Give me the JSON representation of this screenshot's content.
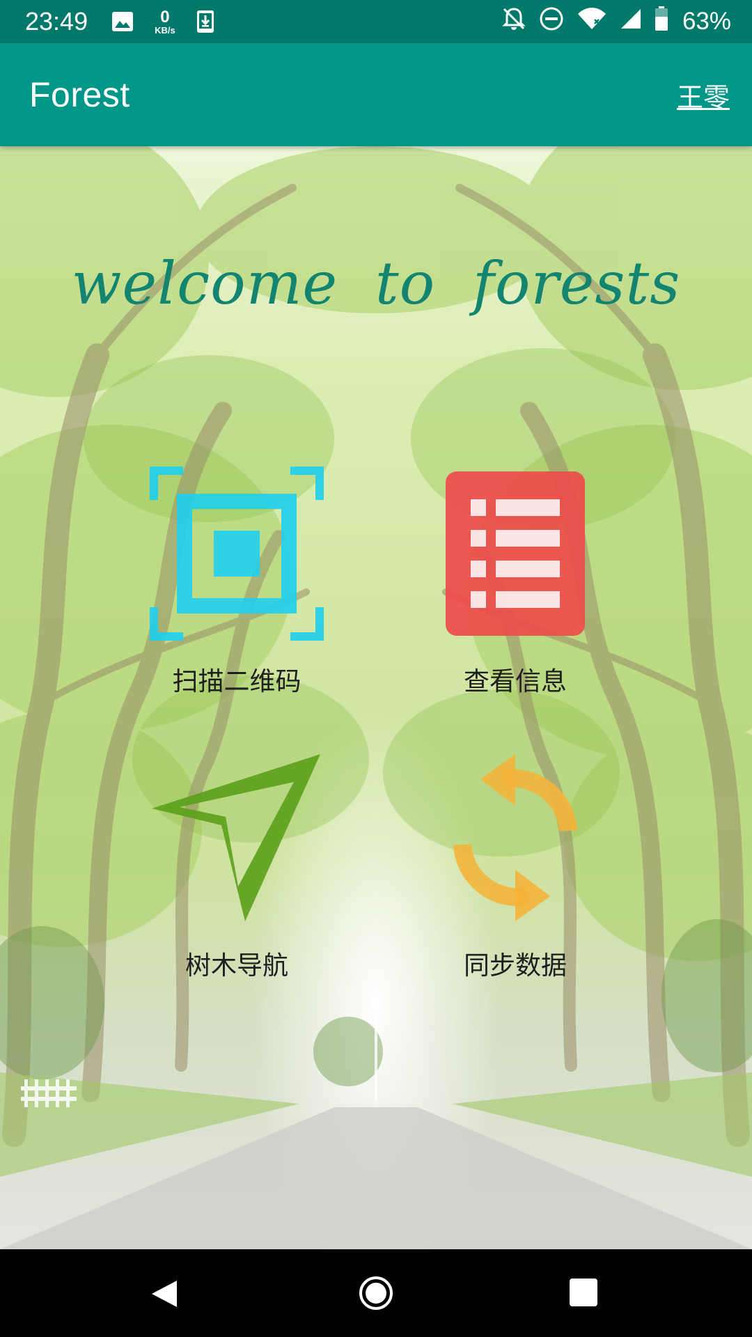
{
  "status_bar": {
    "time": "23:49",
    "net_speed_value": "0",
    "net_speed_unit": "KB/s",
    "battery": "63%",
    "icons": [
      "image-icon",
      "download-icon",
      "notifications-off-icon",
      "do-not-disturb-icon",
      "wifi-icon",
      "signal-icon",
      "battery-icon"
    ]
  },
  "app_bar": {
    "title": "Forest",
    "user": "王零"
  },
  "main": {
    "welcome": "welcome to forests",
    "tiles": [
      {
        "label": "扫描二维码",
        "icon": "qr-scan-icon",
        "color": "#1ecff0"
      },
      {
        "label": "查看信息",
        "icon": "list-info-icon",
        "color": "#ef4b4b"
      },
      {
        "label": "树木导航",
        "icon": "navigation-arrow-icon",
        "color": "#5aa01a"
      },
      {
        "label": "同步数据",
        "icon": "sync-icon",
        "color": "#f4b43a"
      }
    ]
  },
  "nav_bar": {
    "icons": [
      "back-icon",
      "home-icon",
      "recents-icon"
    ]
  },
  "colors": {
    "status_bar": "#00796b",
    "app_bar": "#009688",
    "welcome_text": "#138470"
  }
}
